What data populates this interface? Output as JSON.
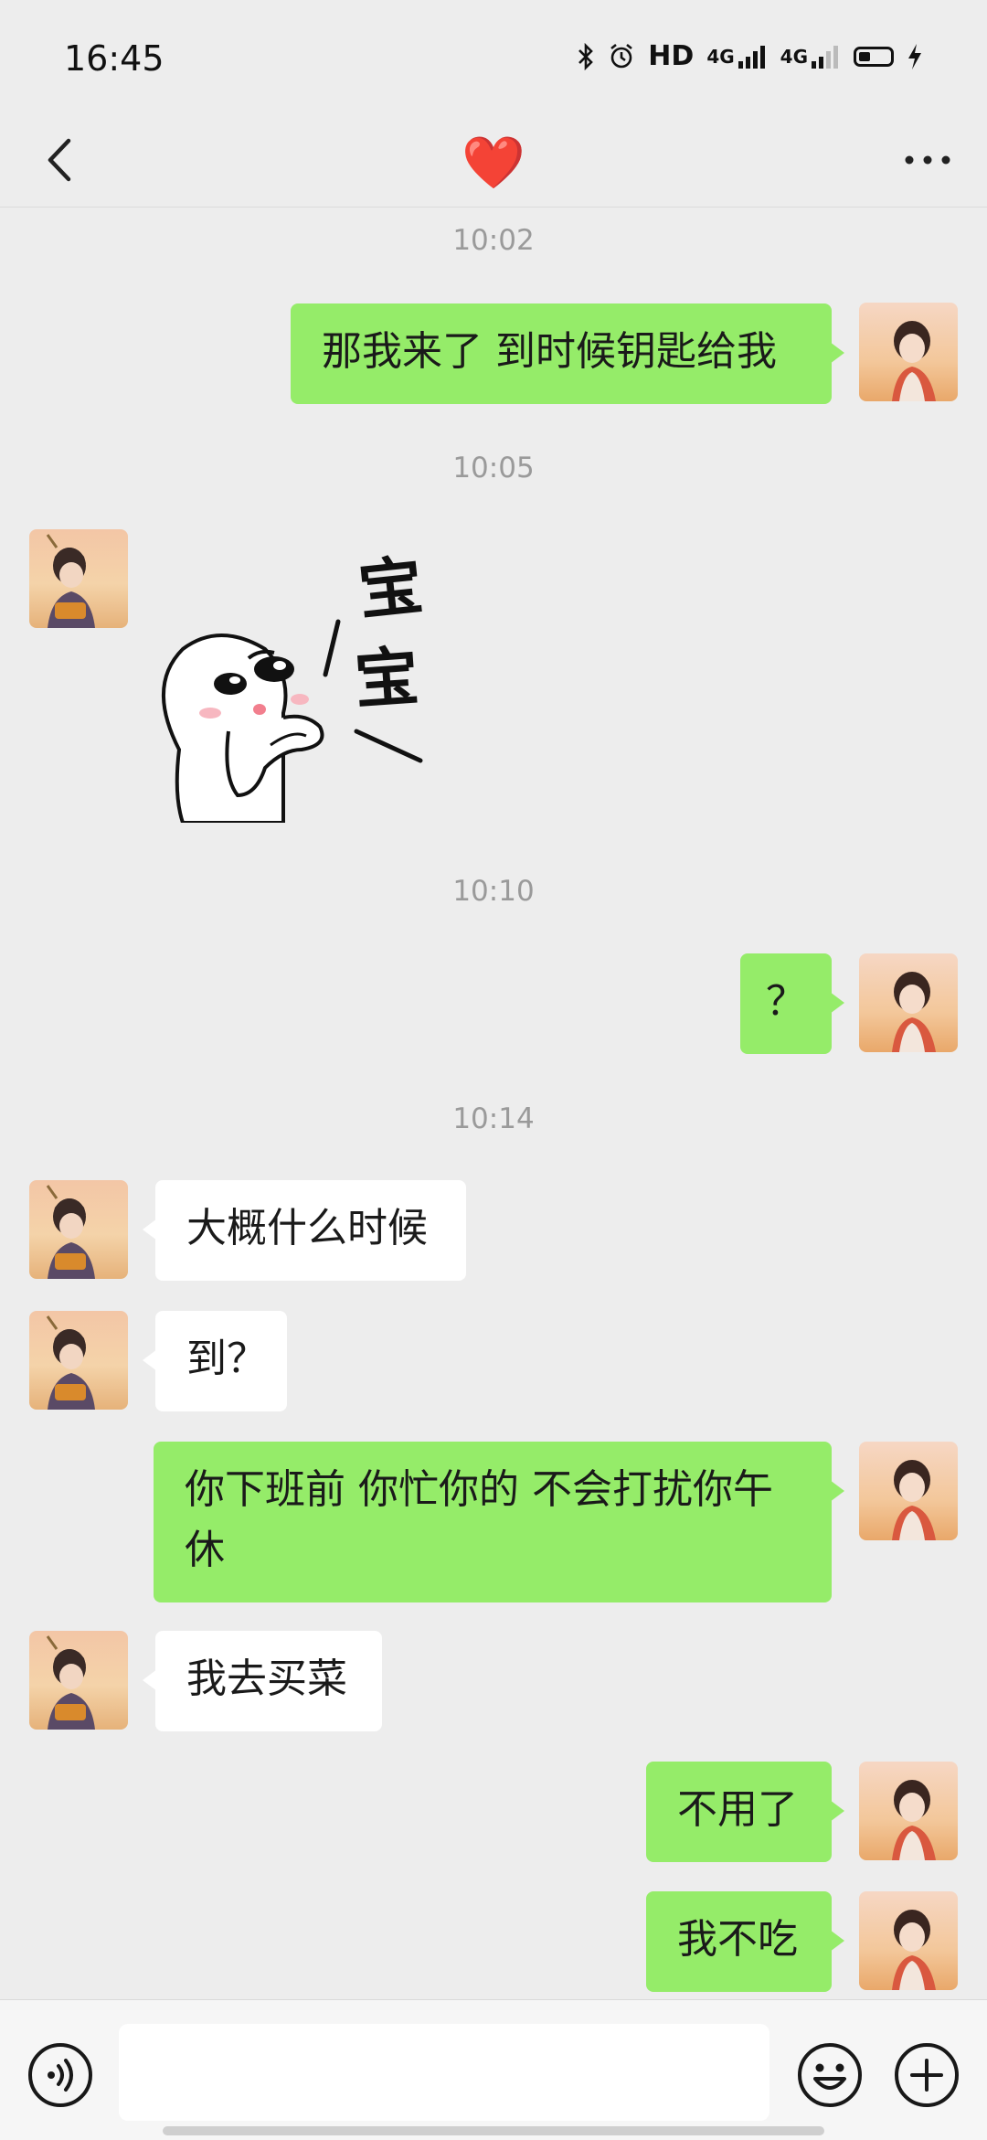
{
  "status_bar": {
    "time": "16:45",
    "hd_label": "HD",
    "network_1": "4G",
    "network_2": "4G",
    "icons": [
      "bluetooth-icon",
      "alarm-icon",
      "signal-icon",
      "battery-icon",
      "charging-icon"
    ]
  },
  "header": {
    "title": "❤️",
    "back_icon": "chevron-left-icon",
    "more_icon": "more-dots-icon"
  },
  "messages": [
    {
      "type": "time",
      "text": "10:02"
    },
    {
      "type": "text",
      "sender": "me",
      "text": "那我来了  到时候钥匙给我"
    },
    {
      "type": "time",
      "text": "10:05"
    },
    {
      "type": "sticker",
      "sender": "them",
      "text": "宝宝"
    },
    {
      "type": "time",
      "text": "10:10"
    },
    {
      "type": "text",
      "sender": "me",
      "text": "？"
    },
    {
      "type": "time",
      "text": "10:14"
    },
    {
      "type": "text",
      "sender": "them",
      "text": "大概什么时候"
    },
    {
      "type": "text",
      "sender": "them",
      "text": "到？"
    },
    {
      "type": "text",
      "sender": "me",
      "text": "你下班前  你忙你的  不会打扰你午休"
    },
    {
      "type": "text",
      "sender": "them",
      "text": "我去买菜"
    },
    {
      "type": "text",
      "sender": "me",
      "text": "不用了"
    },
    {
      "type": "text",
      "sender": "me",
      "text": "我不吃"
    }
  ],
  "input_bar": {
    "input_value": "",
    "icons": [
      "voice-icon",
      "emoji-icon",
      "plus-icon"
    ]
  },
  "colors": {
    "background": "#ededed",
    "my_bubble": "#95ec69",
    "their_bubble": "#ffffff",
    "timestamp": "#9a9a9a",
    "heart": "#e0262f"
  }
}
